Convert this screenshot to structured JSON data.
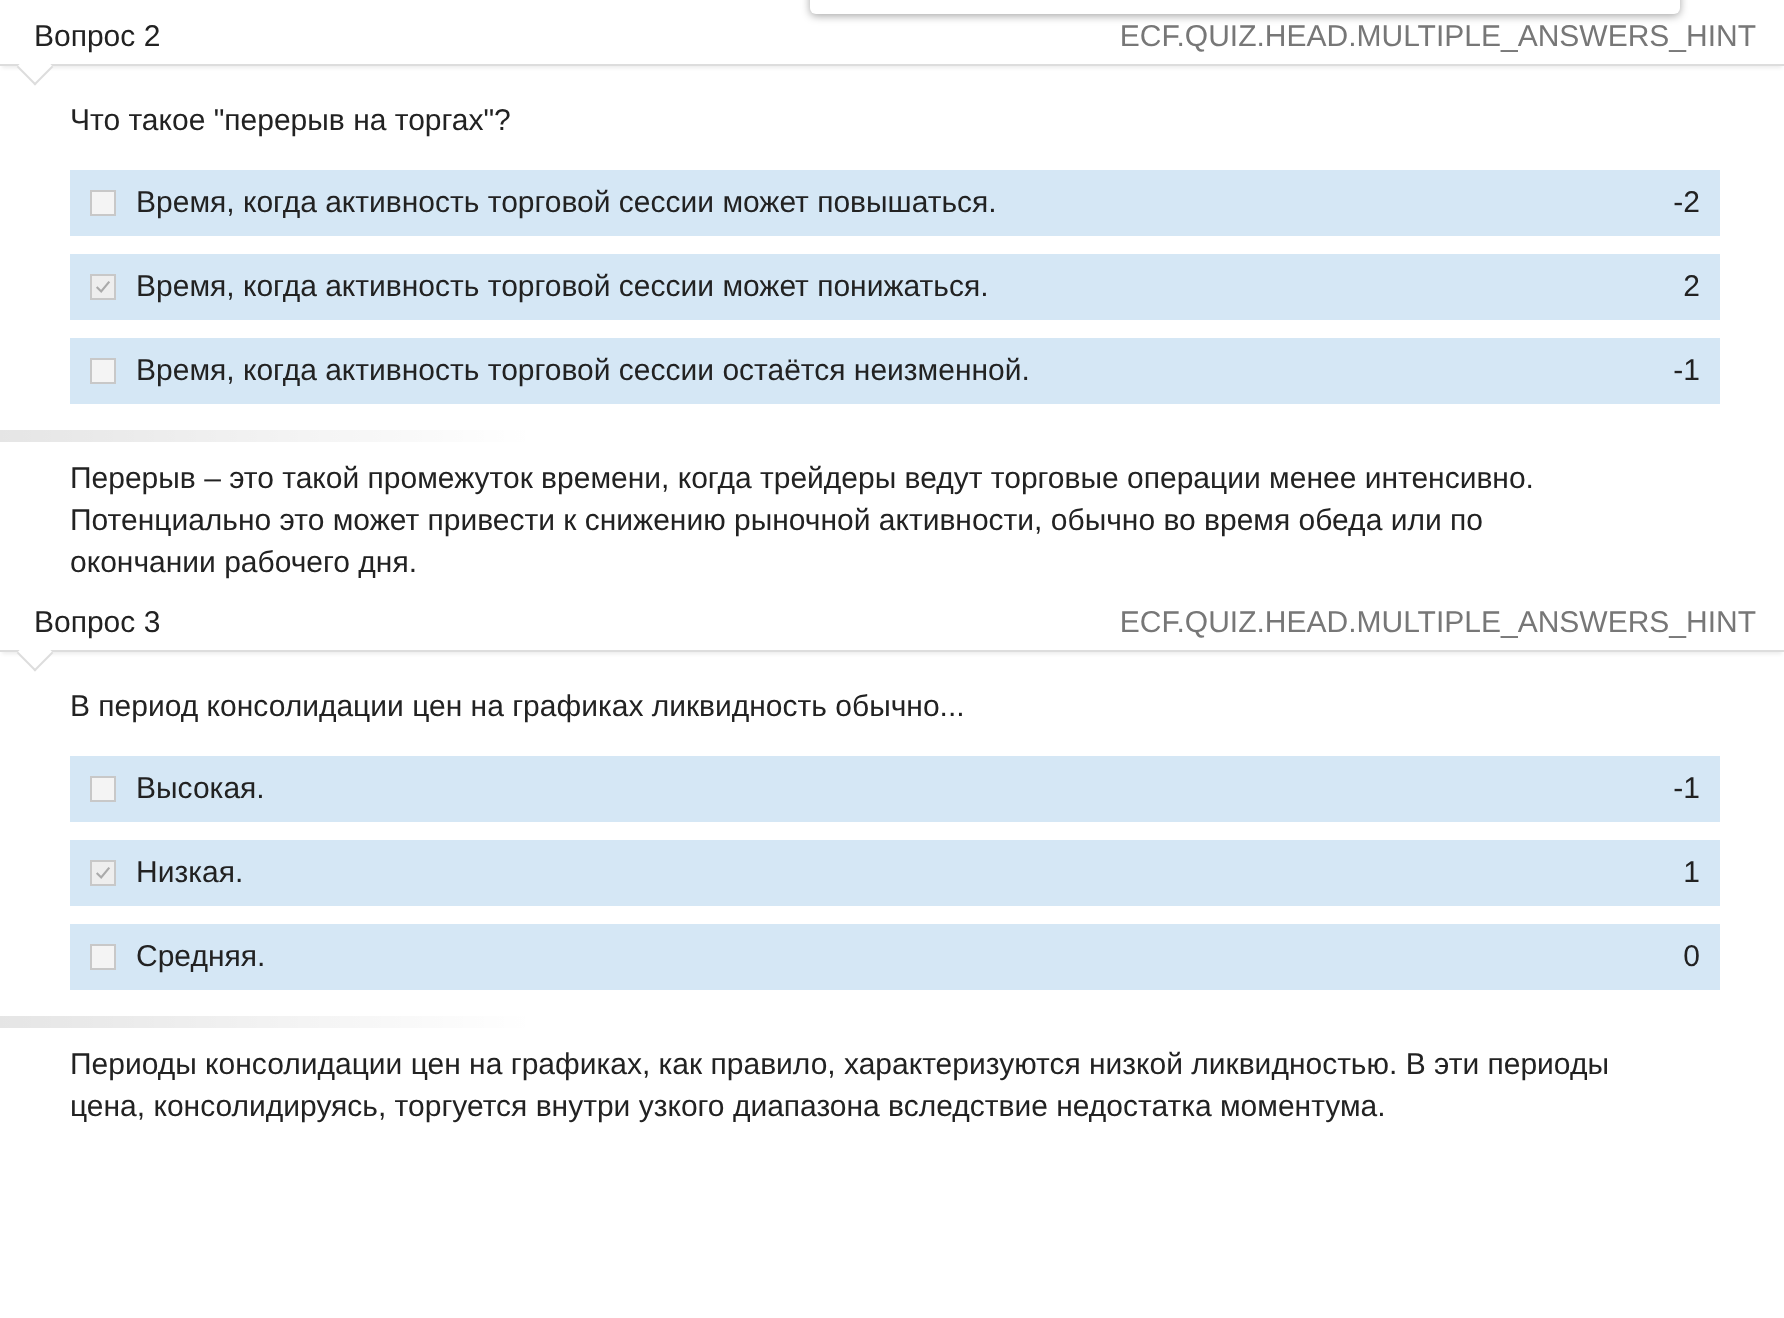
{
  "questions": [
    {
      "title": "Вопрос 2",
      "hint": "ECF.QUIZ.HEAD.MULTIPLE_ANSWERS_HINT",
      "text": "Что такое \"перерыв на торгах\"?",
      "answers": [
        {
          "label": "Время, когда активность торговой сессии может повышаться.",
          "checked": false,
          "score": "-2"
        },
        {
          "label": "Время, когда активность торговой сессии может понижаться.",
          "checked": true,
          "score": "2"
        },
        {
          "label": "Время, когда активность торговой сессии остаётся неизменной.",
          "checked": false,
          "score": "-1"
        }
      ],
      "explanation": "Перерыв – это такой промежуток времени, когда трейдеры ведут торговые операции менее интенсивно. Потенциально это может привести к снижению рыночной активности, обычно во время обеда или по окончании рабочего дня."
    },
    {
      "title": "Вопрос 3",
      "hint": "ECF.QUIZ.HEAD.MULTIPLE_ANSWERS_HINT",
      "text": "В период консолидации цен на графиках ликвидность обычно...",
      "answers": [
        {
          "label": "Высокая.",
          "checked": false,
          "score": "-1"
        },
        {
          "label": "Низкая.",
          "checked": true,
          "score": "1"
        },
        {
          "label": "Средняя.",
          "checked": false,
          "score": "0"
        }
      ],
      "explanation": "Периоды консолидации цен на графиках, как правило, характеризуются низкой ликвидностью. В эти периоды цена, консолидируясь, торгуется внутри узкого диапазона вследствие недостатка моментума."
    }
  ]
}
